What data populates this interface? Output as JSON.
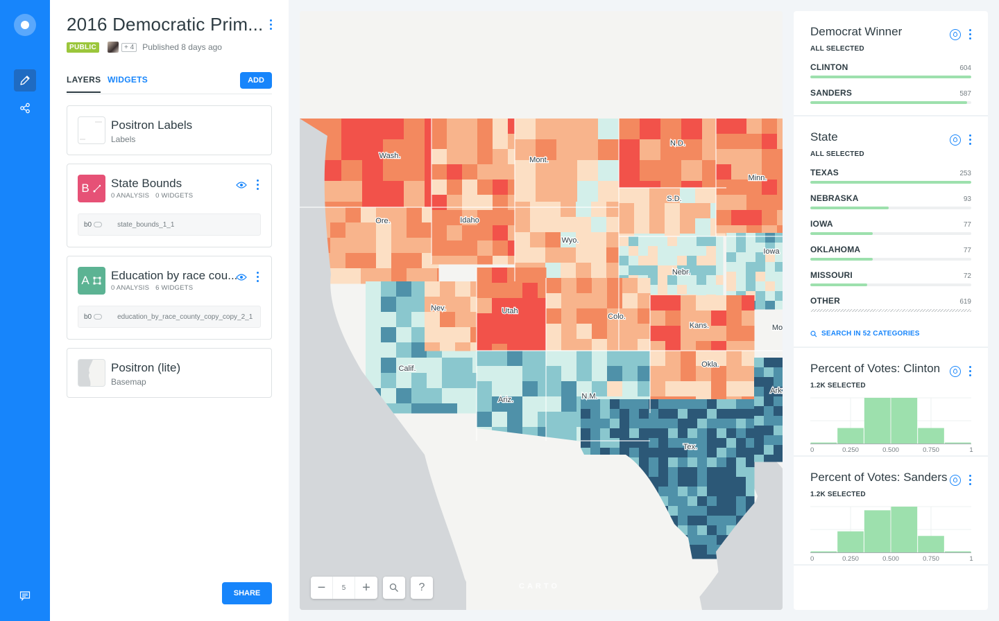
{
  "app": {
    "title": "2016 Democratic Prim...",
    "visibility": "PUBLIC",
    "collaborators_extra": "+ 4",
    "published": "Published 8 days ago"
  },
  "rail": {
    "items": [
      {
        "icon": "pencil-icon",
        "active": true
      },
      {
        "icon": "share-nodes-icon",
        "active": false
      }
    ],
    "bottom_icon": "chat-icon"
  },
  "tabs": [
    {
      "label": "LAYERS",
      "active": true
    },
    {
      "label": "WIDGETS",
      "active": false
    }
  ],
  "add_label": "ADD",
  "layers": [
    {
      "name": "Positron Labels",
      "subtitle": "Labels"
    },
    {
      "letter": "B",
      "name": "State Bounds",
      "analysis": "0 ANALYSIS",
      "widgets": "0 WIDGETS",
      "node_id": "b0",
      "source": "state_bounds_1_1",
      "color": "#E65176"
    },
    {
      "letter": "A",
      "name": "Education by race cou...",
      "analysis": "0 ANALYSIS",
      "widgets": "6 WIDGETS",
      "node_id": "b0",
      "source": "education_by_race_county_copy_copy_2_1",
      "color": "#5CB393"
    },
    {
      "name": "Positron (lite)",
      "subtitle": "Basemap"
    }
  ],
  "share_label": "SHARE",
  "map": {
    "zoom_level": "5",
    "zoom_out": "−",
    "zoom_in": "+",
    "help": "?",
    "attribution": "CARTO",
    "state_labels": [
      "Wash.",
      "Ore.",
      "Idaho",
      "Mont.",
      "Wyo.",
      "N.D.",
      "S.D.",
      "Minn.",
      "Nebr.",
      "Iowa",
      "Nev.",
      "Utah",
      "Colo.",
      "Kans.",
      "Calif.",
      "Ariz.",
      "N.M.",
      "Okla.",
      "Tex.",
      "Ark.",
      "Mo."
    ]
  },
  "widgets": {
    "winner": {
      "title": "Democrat Winner",
      "subtitle": "ALL SELECTED",
      "items": [
        {
          "label": "CLINTON",
          "value": "604",
          "fraction": 1.0
        },
        {
          "label": "SANDERS",
          "value": "587",
          "fraction": 0.972
        }
      ]
    },
    "state": {
      "title": "State",
      "subtitle": "ALL SELECTED",
      "items": [
        {
          "label": "TEXAS",
          "value": "253",
          "fraction": 1.0
        },
        {
          "label": "NEBRASKA",
          "value": "93",
          "fraction": 0.486
        },
        {
          "label": "IOWA",
          "value": "77",
          "fraction": 0.386
        },
        {
          "label": "OKLAHOMA",
          "value": "77",
          "fraction": 0.386
        },
        {
          "label": "MISSOURI",
          "value": "72",
          "fraction": 0.355
        },
        {
          "label": "OTHER",
          "value": "619",
          "fraction": 1.0,
          "hatched": true
        }
      ],
      "search_label": "SEARCH IN 52 CATEGORIES"
    },
    "clinton": {
      "title": "Percent of Votes: Clinton",
      "subtitle": "1.2K SELECTED",
      "ticks": [
        "0",
        "0.250",
        "0.500",
        "0.750",
        "1"
      ]
    },
    "sanders": {
      "title": "Percent of Votes: Sanders",
      "subtitle": "1.2K SELECTED",
      "ticks": [
        "0",
        "0.250",
        "0.500",
        "0.750",
        "1"
      ]
    }
  },
  "chart_data": [
    {
      "type": "bar",
      "title": "Percent of Votes: Clinton",
      "xlabel": "",
      "ylabel": "",
      "categories": [
        "0–0.167",
        "0.167–0.333",
        "0.333–0.5",
        "0.5–0.667",
        "0.667–0.833",
        "0.833–1"
      ],
      "values": [
        0.02,
        0.34,
        1.0,
        1.0,
        0.34,
        0.02
      ],
      "x_ticks": [
        "0",
        "0.250",
        "0.500",
        "0.750",
        "1"
      ],
      "xlim": [
        0,
        1
      ],
      "grid": true
    },
    {
      "type": "bar",
      "title": "Percent of Votes: Sanders",
      "xlabel": "",
      "ylabel": "",
      "categories": [
        "0–0.167",
        "0.167–0.333",
        "0.333–0.5",
        "0.5–0.667",
        "0.667–0.833",
        "0.833–1"
      ],
      "values": [
        0.02,
        0.46,
        0.92,
        1.0,
        0.36,
        0.02
      ],
      "x_ticks": [
        "0",
        "0.250",
        "0.500",
        "0.750",
        "1"
      ],
      "xlim": [
        0,
        1
      ],
      "grid": true
    }
  ],
  "colors": {
    "brand": "#1785FB",
    "widget_bar": "#9DE0AD",
    "public_badge": "#9BC63B",
    "map_scale": [
      "#F2524A",
      "#F3895F",
      "#F8B48C",
      "#FCDFC4",
      "#D3EFEA",
      "#8AC7CE",
      "#4F91A9",
      "#2C5877"
    ]
  }
}
